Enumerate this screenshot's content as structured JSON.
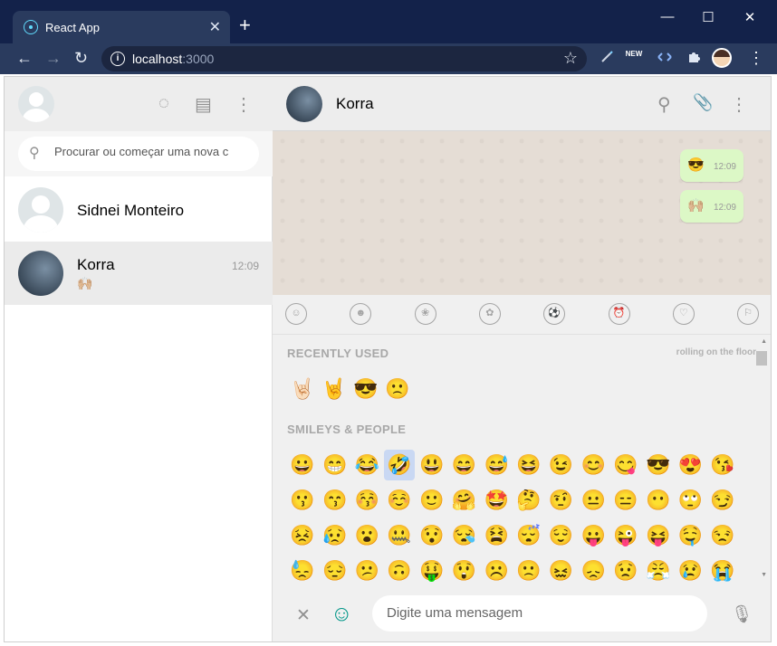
{
  "browser": {
    "tab_title": "React App",
    "tab_close": "✕",
    "new_tab": "+",
    "window_minimize": "—",
    "window_maximize": "☐",
    "window_close": "✕",
    "back": "←",
    "forward": "→",
    "reload": "↻",
    "url_host": "localhost",
    "url_port": ":3000",
    "info_glyph": "i",
    "bookmark_star": "☆",
    "ext_new_label": "NEW",
    "menu_dots": "⋮"
  },
  "sidebar": {
    "search_placeholder": "Procurar ou começar uma nova c",
    "search_glyph": "⚲",
    "status_glyph": "◌",
    "chat_glyph": "▤",
    "menu_glyph": "⋮",
    "chats": [
      {
        "name": "Sidnei Monteiro",
        "time": "",
        "last": ""
      },
      {
        "name": "Korra",
        "time": "12:09",
        "last": "🙌🏼"
      }
    ]
  },
  "main": {
    "contact_name": "Korra",
    "search_glyph": "⚲",
    "attach_glyph": "📎",
    "menu_glyph": "⋮",
    "messages": [
      {
        "text": "😎",
        "time": "12:09"
      },
      {
        "text": "🙌🏼",
        "time": "12:09"
      }
    ]
  },
  "emoji_picker": {
    "categories": [
      "☺",
      "☻",
      "❀",
      "✿",
      "⚽",
      "⏰",
      "♡",
      "⚐"
    ],
    "recently_used_title": "RECENTLY USED",
    "tooltip": "rolling on the floor",
    "recent": [
      "🤘🏻",
      "🤘",
      "😎",
      "🙁"
    ],
    "smileys_title": "SMILEYS & PEOPLE",
    "smileys": [
      "😀",
      "😁",
      "😂",
      "🤣",
      "😃",
      "😄",
      "😅",
      "😆",
      "😉",
      "😊",
      "😋",
      "😎",
      "😍",
      "😘",
      "😗",
      "😙",
      "😚",
      "☺️",
      "🙂",
      "🤗",
      "🤩",
      "🤔",
      "🤨",
      "😐",
      "😑",
      "😶",
      "🙄",
      "😏",
      "😣",
      "😥",
      "😮",
      "🤐",
      "😯",
      "😪",
      "😫",
      "😴",
      "😌",
      "😛",
      "😜",
      "😝",
      "🤤",
      "😒",
      "😓",
      "😔",
      "😕",
      "🙃",
      "🤑",
      "😲",
      "☹️",
      "🙁",
      "😖",
      "😞",
      "😟",
      "😤",
      "😢",
      "😭"
    ],
    "highlighted_index": 3
  },
  "footer": {
    "close_glyph": "✕",
    "emoji_glyph": "☺",
    "placeholder": "Digite uma mensagem",
    "mic_glyph": "🎙"
  },
  "colors": {
    "chrome_dark": "#13224a",
    "chrome_toolbar": "#2a3b5e",
    "bubble_out": "#dcf8c6",
    "chat_bg": "#e5ddd5",
    "emoji_icon_teal": "#009688"
  }
}
